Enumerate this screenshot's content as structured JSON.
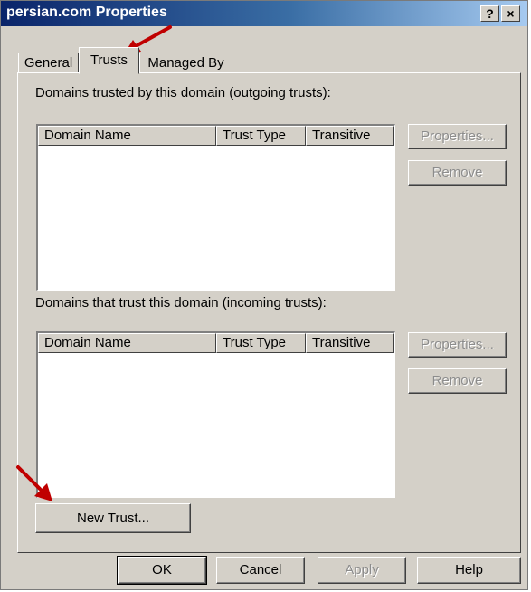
{
  "window": {
    "title": "persian.com Properties",
    "help_button": "?",
    "close_button": "×"
  },
  "tabs": [
    {
      "label": "General",
      "selected": false
    },
    {
      "label": "Trusts",
      "selected": true
    },
    {
      "label": "Managed By",
      "selected": false
    }
  ],
  "outgoing": {
    "label": "Domains trusted by this domain (outgoing trusts):",
    "columns": [
      "Domain Name",
      "Trust Type",
      "Transitive"
    ],
    "rows": [],
    "properties_button": "Properties...",
    "remove_button": "Remove"
  },
  "incoming": {
    "label": "Domains that trust this domain (incoming trusts):",
    "columns": [
      "Domain Name",
      "Trust Type",
      "Transitive"
    ],
    "rows": [],
    "properties_button": "Properties...",
    "remove_button": "Remove"
  },
  "new_trust_button": "New Trust...",
  "footer": {
    "ok": "OK",
    "cancel": "Cancel",
    "apply": "Apply",
    "help": "Help"
  },
  "colors": {
    "arrow": "#c00000",
    "title_start": "#0a246a",
    "dialog_face": "#d4d0c8"
  }
}
